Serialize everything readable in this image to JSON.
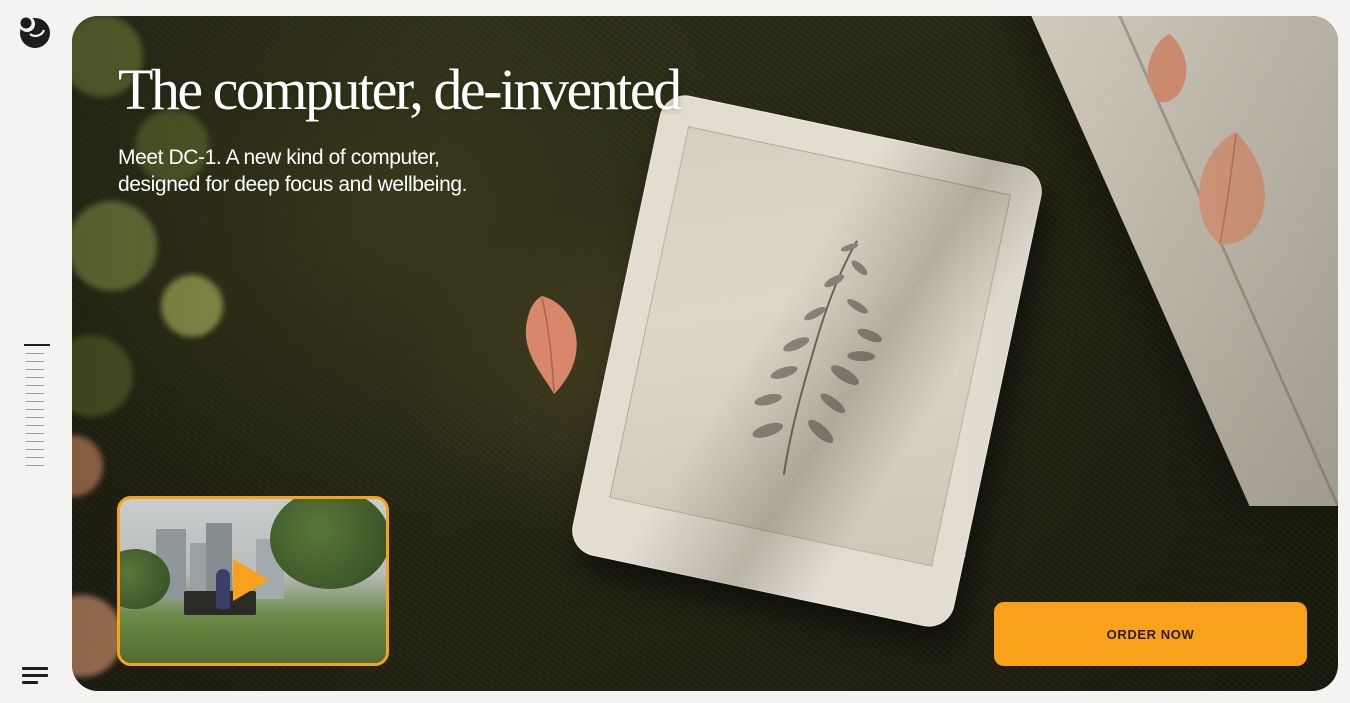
{
  "hero": {
    "headline": "The computer, de-invented",
    "subhead_line1": "Meet DC-1. A new kind of computer,",
    "subhead_line2": "designed for deep focus and wellbeing."
  },
  "cta": {
    "order_label": "ORDER NOW"
  },
  "icons": {
    "logo": "brand-logo-icon",
    "menu": "menu-icon",
    "play": "play-icon"
  },
  "colors": {
    "accent": "#f9a11b",
    "page_bg": "#f4f3f1",
    "text_on_hero": "#ffffff",
    "rail_ink": "#1d1d1b"
  }
}
